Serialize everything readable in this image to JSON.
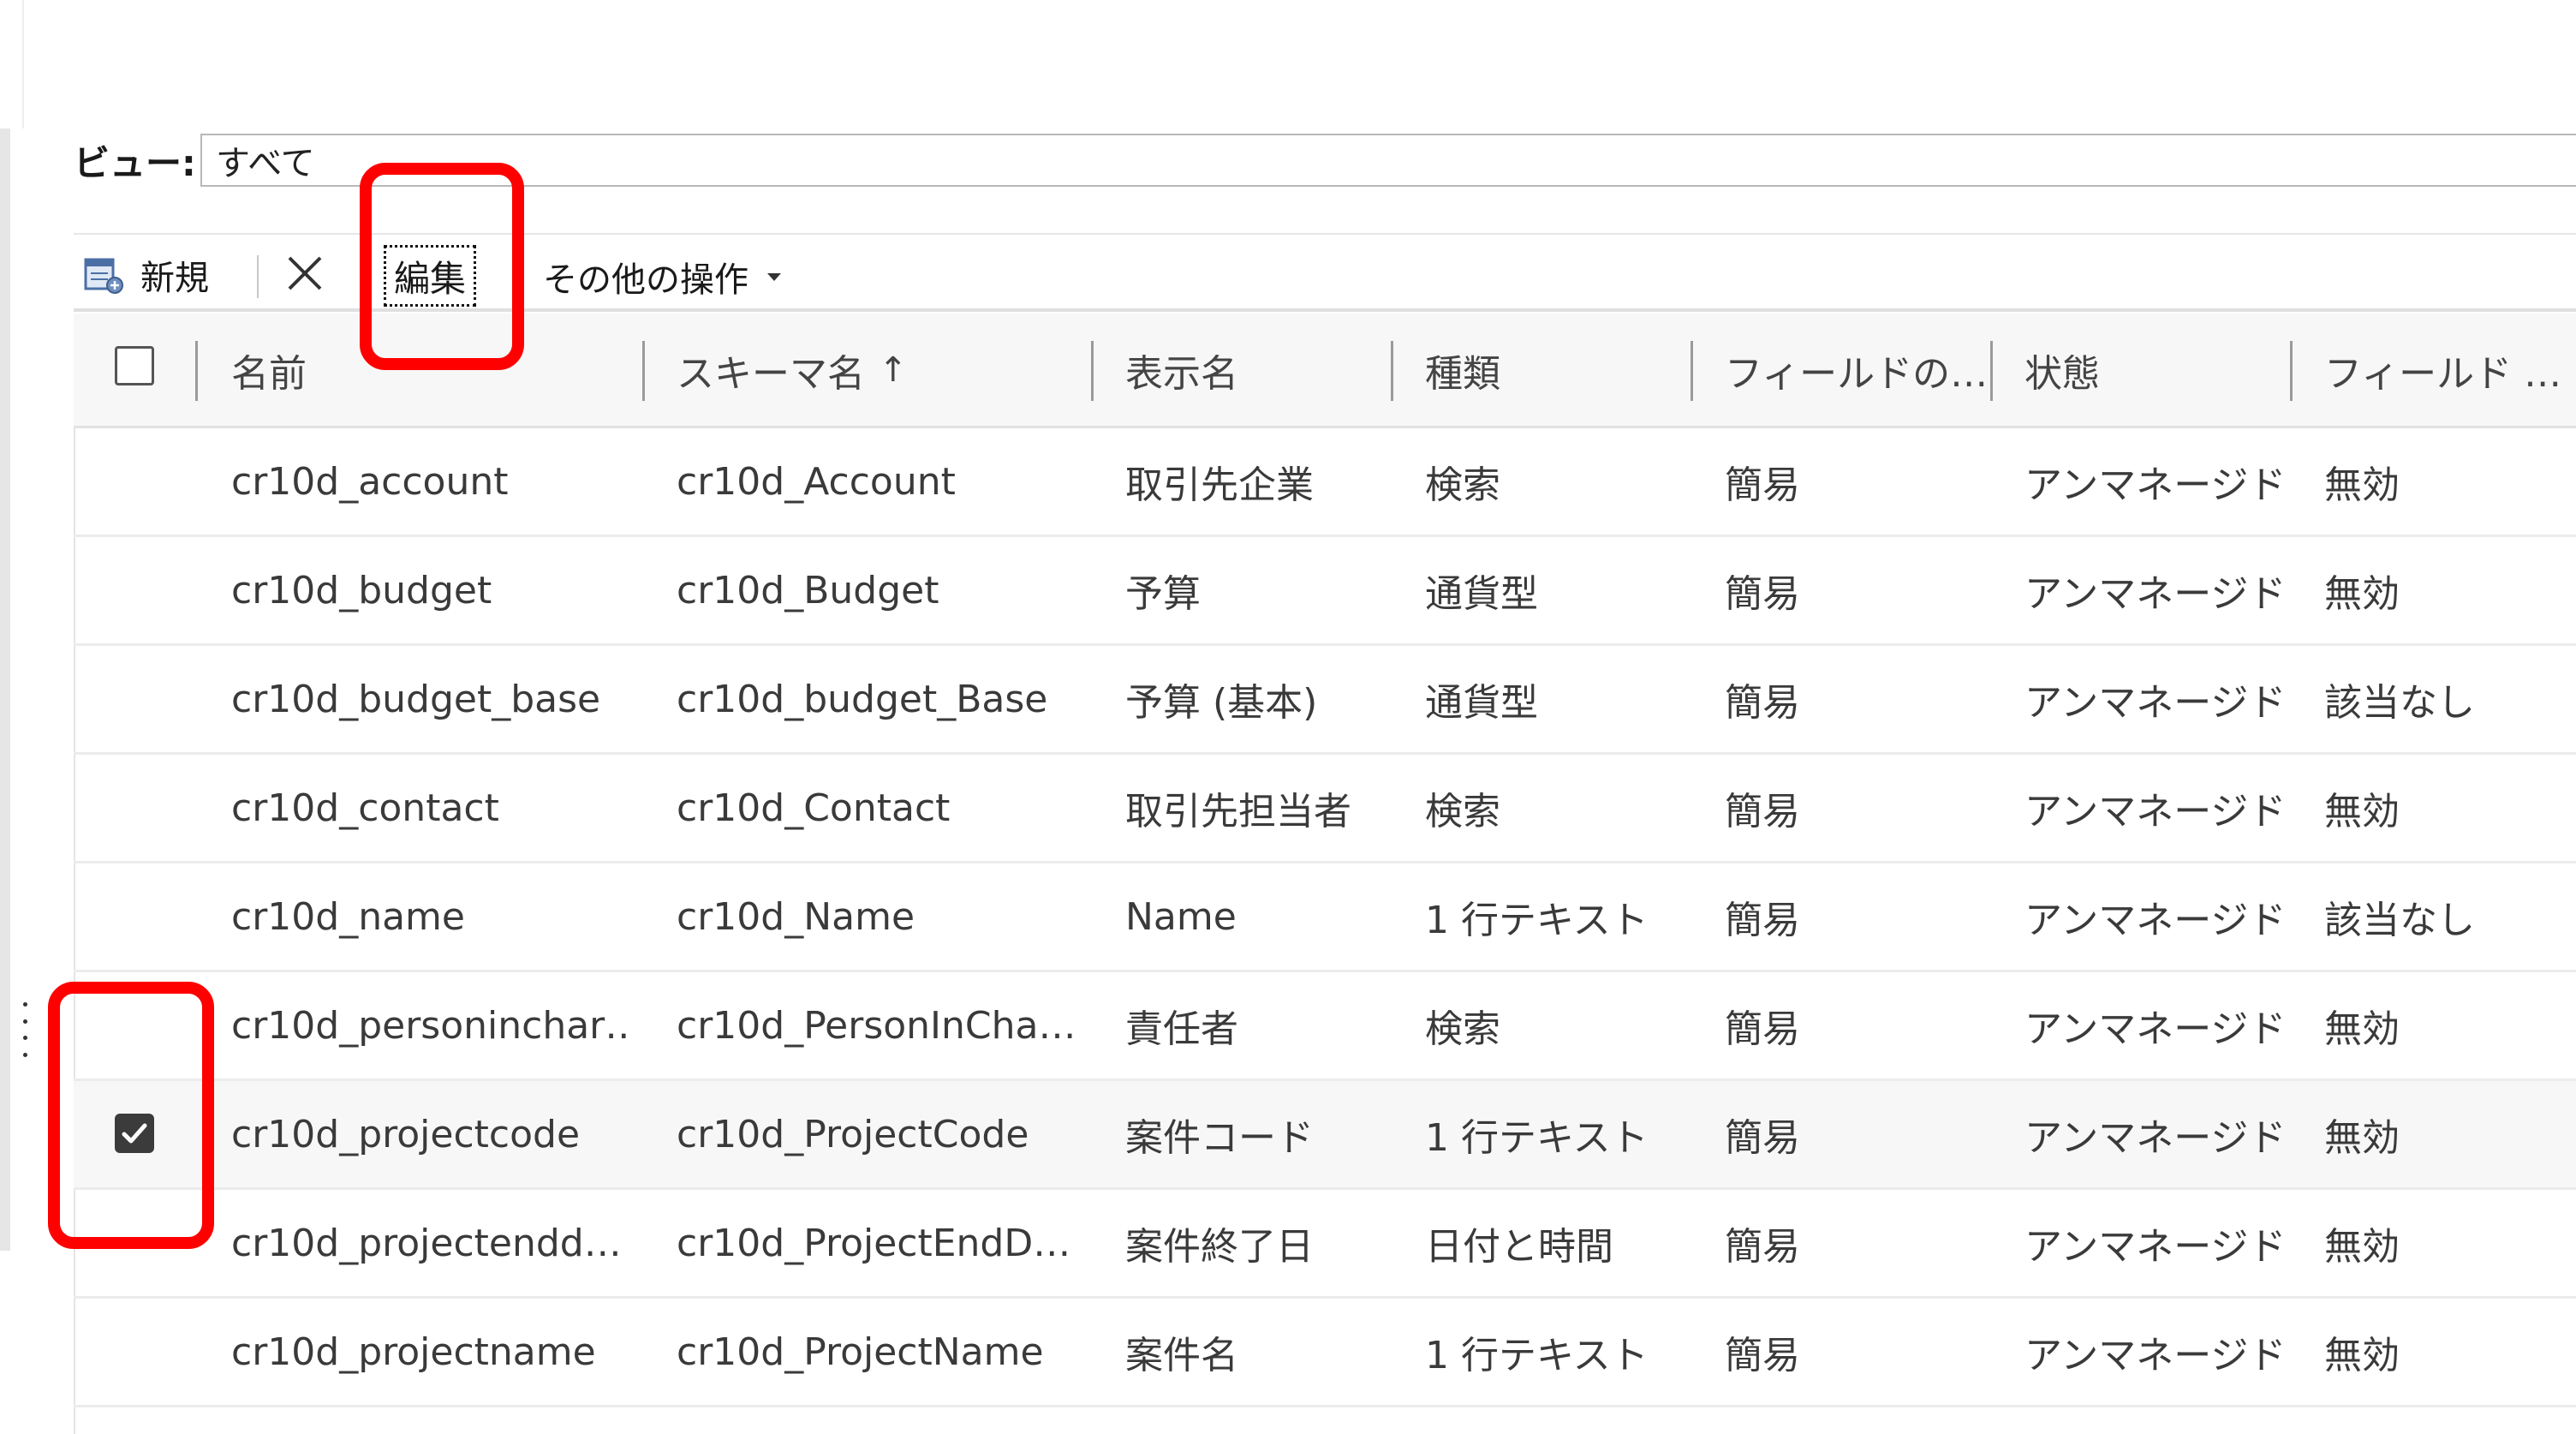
{
  "view": {
    "label": "ビュー:",
    "selected": "すべて"
  },
  "toolbar": {
    "new_label": "新規",
    "new_icon": "new-record-icon",
    "delete_icon": "delete-x-icon",
    "edit_label": "編集",
    "more_label": "その他の操作",
    "more_icon": "chevron-down-icon"
  },
  "columns": [
    {
      "label": "名前"
    },
    {
      "label": "スキーマ名",
      "sorted": "ascending"
    },
    {
      "label": "表示名"
    },
    {
      "label": "種類"
    },
    {
      "label": "フィールドの…"
    },
    {
      "label": "状態"
    },
    {
      "label": "フィールド …"
    }
  ],
  "rows": [
    {
      "name": "cr10d_account",
      "schema": "cr10d_Account",
      "display": "取引先企業",
      "type": "検索",
      "req": "簡易",
      "state": "アンマネージド",
      "field": "無効",
      "checked": false
    },
    {
      "name": "cr10d_budget",
      "schema": "cr10d_Budget",
      "display": "予算",
      "type": "通貨型",
      "req": "簡易",
      "state": "アンマネージド",
      "field": "無効",
      "checked": false
    },
    {
      "name": "cr10d_budget_base",
      "schema": "cr10d_budget_Base",
      "display": "予算 (基本)",
      "type": "通貨型",
      "req": "簡易",
      "state": "アンマネージド",
      "field": "該当なし",
      "checked": false
    },
    {
      "name": "cr10d_contact",
      "schema": "cr10d_Contact",
      "display": "取引先担当者",
      "type": "検索",
      "req": "簡易",
      "state": "アンマネージド",
      "field": "無効",
      "checked": false
    },
    {
      "name": "cr10d_name",
      "schema": "cr10d_Name",
      "display": "Name",
      "type": "1 行テキスト",
      "req": "簡易",
      "state": "アンマネージド",
      "field": "該当なし",
      "checked": false
    },
    {
      "name": "cr10d_personinchar…",
      "schema": "cr10d_PersonInCha…",
      "display": "責任者",
      "type": "検索",
      "req": "簡易",
      "state": "アンマネージド",
      "field": "無効",
      "checked": false
    },
    {
      "name": "cr10d_projectcode",
      "schema": "cr10d_ProjectCode",
      "display": "案件コード",
      "type": "1 行テキスト",
      "req": "簡易",
      "state": "アンマネージド",
      "field": "無効",
      "checked": true
    },
    {
      "name": "cr10d_projectendd…",
      "schema": "cr10d_ProjectEndD…",
      "display": "案件終了日",
      "type": "日付と時間",
      "req": "簡易",
      "state": "アンマネージド",
      "field": "無効",
      "checked": false
    },
    {
      "name": "cr10d_projectname",
      "schema": "cr10d_ProjectName",
      "display": "案件名",
      "type": "1 行テキスト",
      "req": "簡易",
      "state": "アンマネージド",
      "field": "無効",
      "checked": false
    }
  ],
  "colors": {
    "highlight": "#ff0000",
    "checkbox_checked": "#3b3b3b",
    "header_bg": "#f7f7f7"
  }
}
